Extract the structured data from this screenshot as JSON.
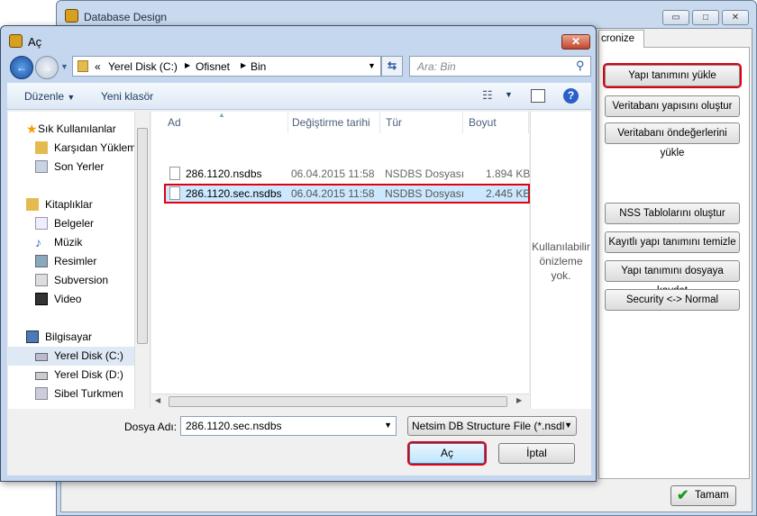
{
  "main_window": {
    "title": "Database Design",
    "tab_label": "cronize",
    "buttons": [
      "Yapı tanımını yükle",
      "Veritabanı yapısını oluştur",
      "Veritabanı öndeğerlerini yükle",
      "NSS Tablolarını oluştur",
      "Kayıtlı yapı tanımını temizle",
      "Yapı tanımını dosyaya kaydet",
      "Security <-> Normal"
    ],
    "ok_label": "Tamam",
    "minimize": "▭",
    "maximize": "□",
    "close": "✕"
  },
  "dialog": {
    "title": "Aç",
    "close": "✕",
    "address": {
      "overflow": "«",
      "crumbs": [
        "Yerel Disk (C:)",
        "Ofisnet",
        "Bin"
      ]
    },
    "search_placeholder": "Ara: Bin",
    "toolbar": {
      "organize": "Düzenle",
      "new_folder": "Yeni klasör"
    },
    "nav": {
      "favorites": "Sık Kullanılanlar",
      "favorites_items": [
        "Karşıdan Yüklem",
        "Son Yerler"
      ],
      "libraries": "Kitaplıklar",
      "library_items": [
        "Belgeler",
        "Müzik",
        "Resimler",
        "Subversion",
        "Video"
      ],
      "computer": "Bilgisayar",
      "computer_items": [
        "Yerel Disk (C:)",
        "Yerel Disk (D:)",
        "Sibel Turkmen"
      ]
    },
    "columns": [
      "Ad",
      "Değiştirme tarihi",
      "Tür",
      "Boyut"
    ],
    "files": [
      {
        "name": "286.1120.nsdbs",
        "date": "06.04.2015 11:58",
        "type": "NSDBS Dosyası",
        "size": "1.894 KB"
      },
      {
        "name": "286.1120.sec.nsdbs",
        "date": "06.04.2015 11:58",
        "type": "NSDBS Dosyası",
        "size": "2.445 KB",
        "selected": true
      }
    ],
    "preview": "Kullanılabilir önizleme yok.",
    "filename_label": "Dosya Adı:",
    "filename_value": "286.1120.sec.nsdbs",
    "filter": "Netsim DB Structure File (*.nsdl",
    "open_label": "Aç",
    "cancel_label": "İptal"
  },
  "colors": {
    "highlight": "#e00010",
    "selection": "#cce8ff"
  }
}
